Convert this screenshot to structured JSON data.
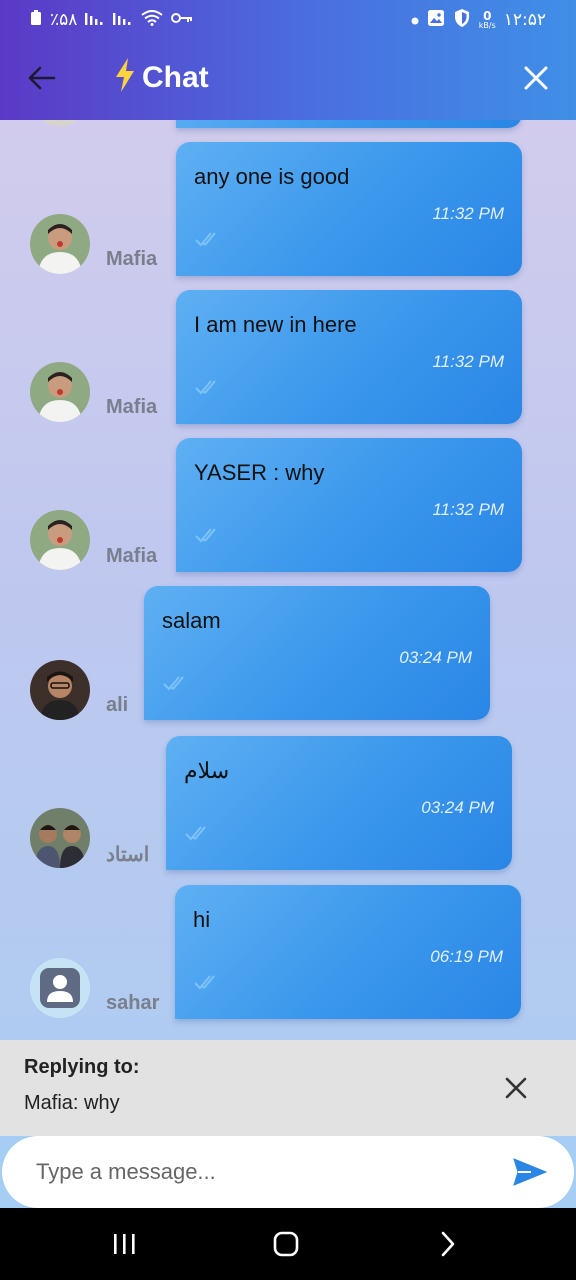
{
  "status_bar": {
    "left_text": "٪۵۸",
    "time": "۱۲:۵۲",
    "net_speed_value": "0",
    "net_speed_unit": "kB/s",
    "icons_left": [
      "battery-icon",
      "signal-icon",
      "signal-icon",
      "wifi-icon",
      "key-icon"
    ],
    "icons_right": [
      "dot-icon",
      "gallery-icon",
      "shield-icon"
    ]
  },
  "appbar": {
    "title": "Chat",
    "title_icon": "lightning-icon",
    "back_icon": "arrow-left-icon",
    "close_icon": "close-icon"
  },
  "messages": [
    {
      "text": "any one is good",
      "time": "11:32 PM",
      "sender": "Mafia",
      "avatar": "avatar-mafia"
    },
    {
      "text": "I am new in here",
      "time": "11:32 PM",
      "sender": "Mafia",
      "avatar": "avatar-mafia"
    },
    {
      "text": "YASER : why",
      "time": "11:32 PM",
      "sender": "Mafia",
      "avatar": "avatar-mafia"
    },
    {
      "text": "salam",
      "time": "03:24 PM",
      "sender": "ali",
      "avatar": "avatar-ali"
    },
    {
      "text": "سلام",
      "time": "03:24 PM",
      "sender": "استاد",
      "avatar": "avatar-ostad"
    },
    {
      "text": "hi",
      "time": "06:19 PM",
      "sender": "sahar",
      "avatar": "avatar-default"
    }
  ],
  "reply": {
    "title": "Replying to:",
    "text": "Mafia: why"
  },
  "composer": {
    "placeholder": "Type a message..."
  },
  "colors": {
    "accent": "#2a86e5",
    "bolt": "#ffd43b",
    "header_start": "#5b39c6",
    "header_end": "#3f8fe6"
  }
}
